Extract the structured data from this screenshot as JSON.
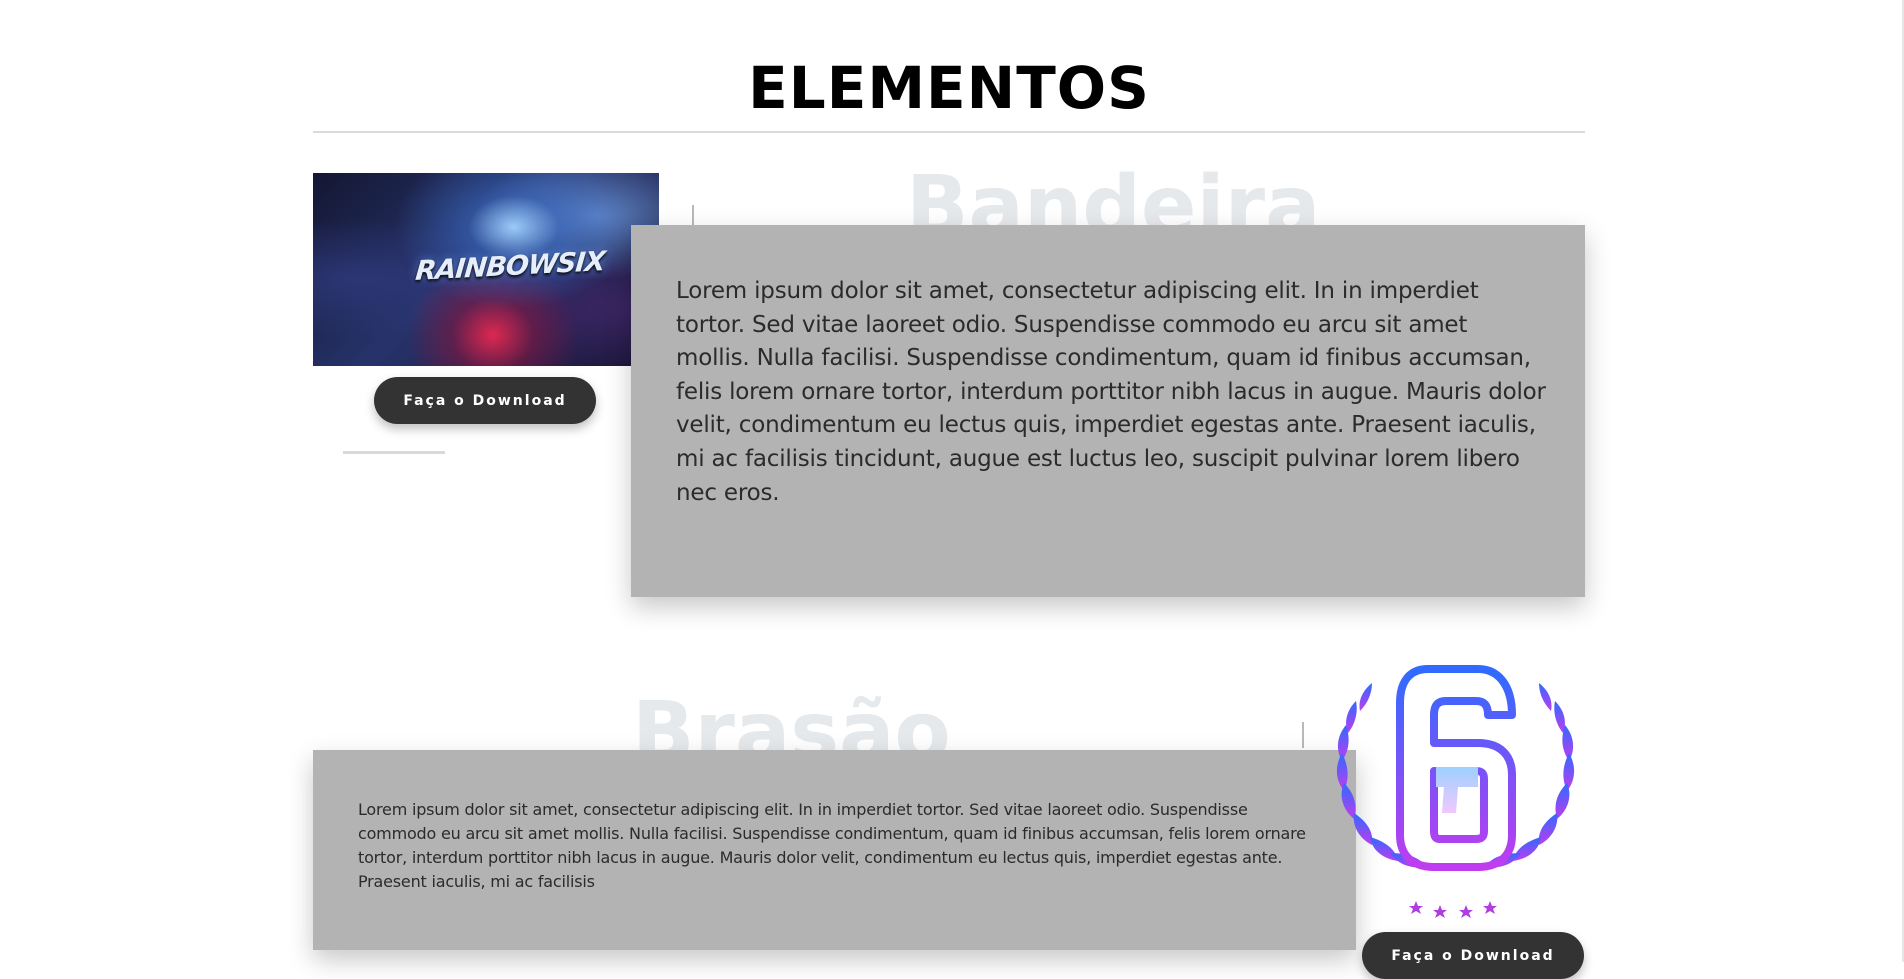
{
  "section": {
    "title": "ELEMENTOS"
  },
  "items": [
    {
      "bg_word": "Bandeira",
      "image_logo_text": "RAINBOWSIX",
      "download_label": "Faça o Download",
      "description": "Lorem ipsum dolor sit amet, consectetur adipiscing elit. In in imperdiet tortor. Sed vitae laoreet odio. Suspendisse commodo eu arcu sit amet mollis. Nulla facilisi. Suspendisse condimentum, quam id finibus accumsan, felis lorem ornare tortor, interdum porttitor nibh lacus in augue. Mauris dolor velit, condimentum eu lectus quis, imperdiet egestas ante. Praesent iaculis, mi ac facilisis tincidunt, augue est luctus leo, suscipit pulvinar lorem libero nec eros."
    },
    {
      "bg_word": "Brasão",
      "download_label": "Faça o Download",
      "description": "Lorem ipsum dolor sit amet, consectetur adipiscing elit. In in imperdiet tortor. Sed vitae laoreet odio. Suspendisse commodo eu arcu sit amet mollis. Nulla facilisi. Suspendisse condimentum, quam id finibus accumsan, felis lorem ornare tortor, interdum porttitor nibh lacus in augue. Mauris dolor velit, condimentum eu lectus quis, imperdiet egestas ante. Praesent iaculis, mi ac facilisis"
    }
  ],
  "icons": {
    "banner_image": "rainbow-six-banner",
    "emblem": "rainbow-six-laurel-emblem"
  },
  "colors": {
    "card_bg": "#b3b3b3",
    "button_bg": "#333333",
    "emblem_gradient_top": "#2f6bff",
    "emblem_gradient_bottom": "#c03cf0",
    "emblem_gun": "#9dd0ff"
  }
}
